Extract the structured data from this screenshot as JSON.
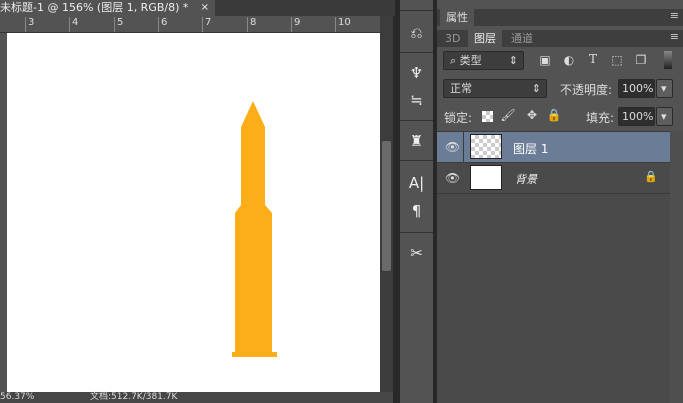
{
  "document": {
    "tab_title": "未标题-1 @ 156% (图层 1, RGB/8) *",
    "close": "×",
    "ruler_ticks": [
      "3",
      "4",
      "5",
      "6",
      "7",
      "8",
      "9",
      "10"
    ],
    "shape_color": "#FBAE17"
  },
  "status": {
    "zoom": "56.37%",
    "doc_info": "文档:512.7K/381.7K"
  },
  "tools": [
    "history-icon",
    "brush-presets-icon",
    "brush-icon",
    "clone-source-icon",
    "character-icon",
    "paragraph-icon",
    "tool-presets-icon"
  ],
  "panel": {
    "properties_tab": "属性",
    "tabs": [
      "3D",
      "图层",
      "通道"
    ],
    "filter": {
      "label": "类型",
      "icons": [
        "image-filter-icon",
        "adjustment-filter-icon",
        "type-filter-icon",
        "shape-filter-icon",
        "smart-object-filter-icon"
      ]
    },
    "blend": {
      "mode": "正常",
      "opacity_label": "不透明度:",
      "opacity": "100%"
    },
    "lock": {
      "label": "锁定:",
      "fill_label": "填充:",
      "fill": "100%"
    },
    "layers": [
      {
        "name": "图层 1",
        "selected": true
      },
      {
        "name": "背景",
        "locked": true
      }
    ]
  }
}
